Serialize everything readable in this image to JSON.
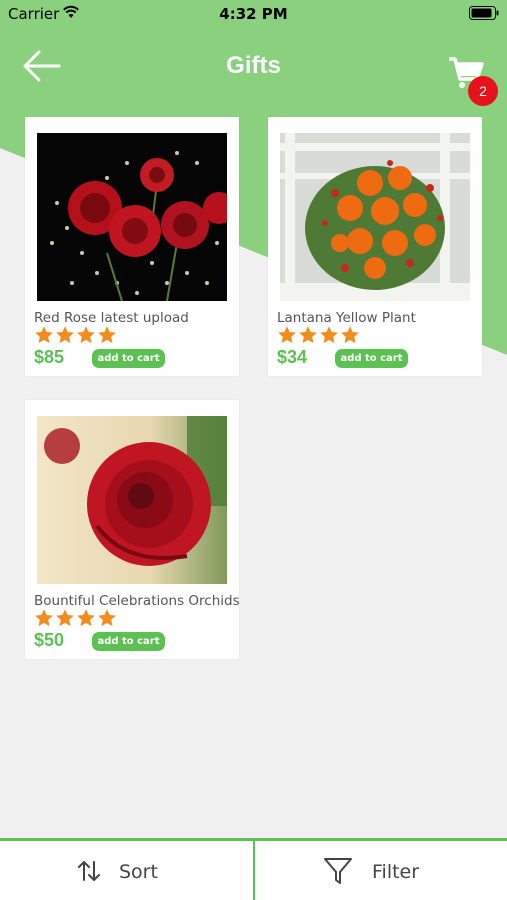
{
  "status_bar": {
    "carrier": "Carrier",
    "time": "4:32 PM"
  },
  "header": {
    "title": "Gifts",
    "cart_count": "2",
    "icons": {
      "back": "arrow-left-icon",
      "cart": "shopping-cart-icon"
    }
  },
  "colors": {
    "header_green": "#8ad07f",
    "accent_green": "#5cc152",
    "badge_red": "#e8121a",
    "star_orange": "#f28c1c"
  },
  "products": [
    {
      "name": "Red Rose latest upload",
      "rating": 4,
      "price": "$85",
      "button": "add to cart"
    },
    {
      "name": "Lantana Yellow  Plant",
      "rating": 4,
      "price": "$34",
      "button": "add to cart"
    },
    {
      "name": "Bountiful Celebrations  Orchids Sp",
      "rating": 4,
      "price": "$50",
      "button": "add to cart"
    }
  ],
  "bottom_bar": {
    "sort_label": "Sort",
    "filter_label": "Filter",
    "icons": {
      "sort": "sort-arrows-icon",
      "filter": "funnel-icon"
    }
  }
}
